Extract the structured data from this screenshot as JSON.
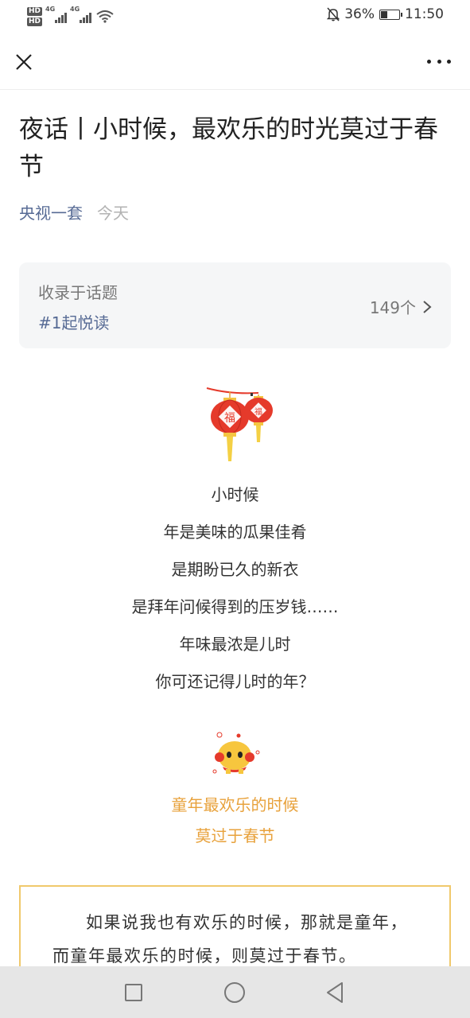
{
  "status_bar": {
    "hd1": "HD",
    "hd2": "HD",
    "net1": "4G",
    "net2": "4G",
    "battery_text": "36%",
    "battery_level": 0.36,
    "time": "11:50"
  },
  "article": {
    "title": "夜话丨小时候，最欢乐的时光莫过于春节",
    "author": "央视一套",
    "date": "今天"
  },
  "topic": {
    "label": "收录于话题",
    "name": "#1起悦读",
    "count": "149个"
  },
  "content": {
    "poem": [
      "小时候",
      "年是美味的瓜果佳肴",
      "是期盼已久的新衣",
      "是拜年问候得到的压岁钱……",
      "年味最浓是儿时",
      "你可还记得儿时的年？"
    ],
    "highlight": [
      "童年最欢乐的时候",
      "莫过于春节"
    ],
    "paragraph": "如果说我也有欢乐的时候，那就是童年，而童年最欢乐的时候，则莫过于春节。",
    "lantern_char": "福"
  },
  "colors": {
    "link": "#576b95",
    "accent_orange": "#e8a23c",
    "box_border": "#f0c96c",
    "lantern_red": "#e53a2b"
  }
}
